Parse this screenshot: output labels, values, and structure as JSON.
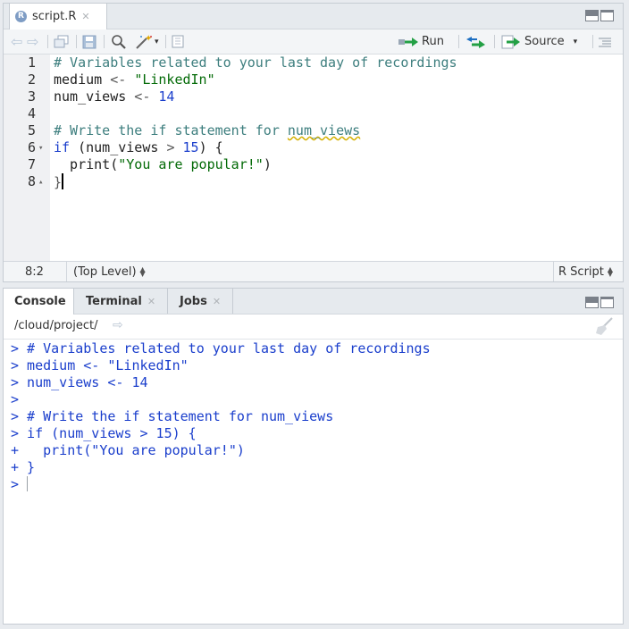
{
  "editor": {
    "tab_label": "script.R",
    "tab_icon": "r-file-icon",
    "toolbar": {
      "run_label": "Run",
      "source_label": "Source"
    },
    "lines": [
      {
        "num": "1",
        "fold": ""
      },
      {
        "num": "2",
        "fold": ""
      },
      {
        "num": "3",
        "fold": ""
      },
      {
        "num": "4",
        "fold": ""
      },
      {
        "num": "5",
        "fold": ""
      },
      {
        "num": "6",
        "fold": "▾"
      },
      {
        "num": "7",
        "fold": ""
      },
      {
        "num": "8",
        "fold": "▴"
      }
    ],
    "code": {
      "l1": "# Variables related to your last day of recordings",
      "l2a": "medium",
      "l2b": " <- ",
      "l2c": "\"LinkedIn\"",
      "l3a": "num_views",
      "l3b": " <- ",
      "l3c": "14",
      "l5a": "# Write the if statement for ",
      "l5b": "num_views",
      "l6a": "if",
      "l6b": " (num_views ",
      "l6c": ">",
      "l6d": " ",
      "l6e": "15",
      "l6f": ") {",
      "l7a": "  print(",
      "l7b": "\"You are popular!\"",
      "l7c": ")",
      "l8": "}"
    },
    "status": {
      "position": "8:2",
      "scope": "(Top Level)",
      "filetype": "R Script"
    }
  },
  "console_pane": {
    "tabs": [
      {
        "label": "Console"
      },
      {
        "label": "Terminal"
      },
      {
        "label": "Jobs"
      }
    ],
    "path": "/cloud/project/",
    "lines": [
      "> # Variables related to your last day of recordings",
      "> medium <- \"LinkedIn\"",
      "> num_views <- 14",
      ">",
      "> # Write the if statement for num_views",
      "> if (num_views > 15) {",
      "+   print(\"You are popular!\")",
      "+ }",
      "> "
    ]
  },
  "colors": {
    "comment": "#3d7e7e",
    "string": "#036a07",
    "keyword": "#1a3ecc",
    "console_text": "#1a3ecc"
  }
}
